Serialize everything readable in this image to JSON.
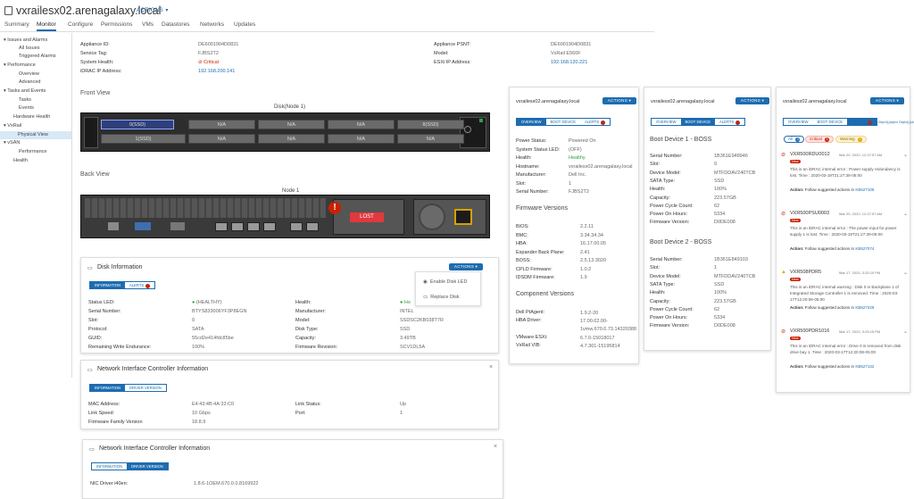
{
  "header": {
    "title": "vxrailesx02.arenagalaxy.local",
    "actions": "ACTIONS"
  },
  "tabs": [
    "Summary",
    "Monitor",
    "Configure",
    "Permissions",
    "VMs",
    "Datastores",
    "Networks",
    "Updates"
  ],
  "sidebar": {
    "items": [
      "Issues and Alarms",
      "All Issues",
      "Triggered Alarms",
      "Performance",
      "Overview",
      "Advanced",
      "Tasks and Events",
      "Tasks",
      "Events",
      "Hardware Health",
      "VxRail",
      "Physical View",
      "vSAN",
      "Performance",
      "Health"
    ]
  },
  "info": {
    "left": [
      [
        "Appliance ID:",
        "DE6001904D0831"
      ],
      [
        "Service Tag:",
        "FJBS2T2"
      ],
      [
        "System Health:",
        "Critical"
      ],
      [
        "iDRAC IP Address:",
        "192.168.200.141"
      ]
    ],
    "right": [
      [
        "Appliance PSNT:",
        "DE6001904D0831"
      ],
      [
        "Model:",
        "VxRail E560F"
      ],
      [
        "ESXi IP Address:",
        "192.168.120.221"
      ]
    ]
  },
  "front": {
    "label": "Front View",
    "node": "Disk(Node 1)",
    "slots": [
      "0(SSD)",
      "N/A",
      "N/A",
      "N/A",
      "N/A",
      "8(SSD)",
      "1(SSD)",
      "N/A",
      "N/A",
      "N/A",
      "N/A",
      "N/A"
    ]
  },
  "back": {
    "label": "Back View",
    "node": "Node 1",
    "lost": "LOST"
  },
  "disk": {
    "title": "Disk Information",
    "tabs": [
      "INFORMATION",
      "ALERTS"
    ],
    "alerts_count": "1",
    "actions": "ACTIONS",
    "menu": [
      "Enable Disk LED",
      "Replace Disk"
    ],
    "left": [
      [
        "Status LED:",
        "(HEALTHY)"
      ],
      [
        "Serial Number:",
        "BTYS833006YF3P8EGN"
      ],
      [
        "Slot:",
        "0"
      ],
      [
        "Protocol:",
        "SATA"
      ],
      [
        "GUID:",
        "55cd2e414fdc85be"
      ],
      [
        "Remaining Write Endurance:",
        "100%"
      ]
    ],
    "right": [
      [
        "Health:",
        "Ho"
      ],
      [
        "Manufacturer:",
        "INTEL"
      ],
      [
        "Model:",
        "SSDSC2KB038T7R"
      ],
      [
        "Disk Type:",
        "SSD"
      ],
      [
        "Capacity:",
        "3.49TB"
      ],
      [
        "Firmware Revision:",
        "SCV1DL5A"
      ]
    ]
  },
  "nic1": {
    "title": "Network Interface Controller Information",
    "tabs": [
      "INFORMATION",
      "DRIVER VERSION"
    ],
    "left": [
      [
        "MAC Address:",
        "E4:43:4B:4A:33:C0"
      ],
      [
        "Link Speed:",
        "10 Gbps"
      ],
      [
        "Firmware Family Version",
        "18.8.9"
      ]
    ],
    "right": [
      [
        "Link Status:",
        "Up"
      ],
      [
        "Port:",
        "1"
      ]
    ]
  },
  "nic2": {
    "title": "Network Interface Controller Information",
    "tabs": [
      "INFORMATION",
      "DRIVER VERSION"
    ],
    "rows": [
      [
        "NIC Driver i40en:",
        "1.8.6-1OEM.670.0.0.8169922"
      ]
    ]
  },
  "p1": {
    "host": "vxrailesx02.arenagalaxy.local",
    "actions": "ACTIONS",
    "tabs": [
      "OVERVIEW",
      "BOOT DEVICE",
      "ALERTS"
    ],
    "alerts": "5",
    "rows": [
      [
        "Power Status:",
        "Powered On"
      ],
      [
        "System Status LED:",
        "(OFF)"
      ],
      [
        "Health:",
        "Healthy"
      ],
      [
        "Hostname:",
        "vxrailesx02.arenagalaxy.local"
      ],
      [
        "Manufacturer:",
        "Dell Inc."
      ],
      [
        "Slot:",
        "1"
      ],
      [
        "Serial Number:",
        "FJBS2T2"
      ]
    ],
    "fw_title": "Firmware Versions",
    "fw": [
      [
        "BIOS:",
        "2.2.11"
      ],
      [
        "BMC:",
        "3.34.34.34"
      ],
      [
        "HBA:",
        "16.17.00.05"
      ],
      [
        "Expander Back Plane:",
        "2.41"
      ],
      [
        "BOSS:",
        "2.5.13.3020"
      ],
      [
        "CPLD Firmware:",
        "1.0.2"
      ],
      [
        "IDSDM Firmware:",
        "1.9"
      ]
    ],
    "comp_title": "Component Versions",
    "comp": [
      [
        "Dell PtAgent:",
        "1.9.2-20"
      ],
      [
        "HBA Driver:",
        "17.00.02.00-1vmw.670.0.73.14320388"
      ],
      [
        "VMware ESXi:",
        "6.7.0-15018017"
      ],
      [
        "VxRail VIB:",
        "4.7.301-15195814"
      ]
    ]
  },
  "p2": {
    "host": "vxrailesx02.arenagalaxy.local",
    "actions": "ACTIONS",
    "tabs": [
      "OVERVIEW",
      "BOOT DEVICE",
      "ALERTS"
    ],
    "alerts": "5",
    "b1": "Boot Device 1 - BOSS",
    "b1rows": [
      [
        "Serial Number:",
        "1B361E948946"
      ],
      [
        "Slot:",
        "0"
      ],
      [
        "Device Model:",
        "MTFDDAV240TCB"
      ],
      [
        "SATA Type:",
        "SSD"
      ],
      [
        "Health:",
        "100%"
      ],
      [
        "Capacity:",
        "223.57GB"
      ],
      [
        "Power Cycle Count:",
        "62"
      ],
      [
        "Power On Hours:",
        "5334"
      ],
      [
        "Firmware Version:",
        "D0DE008"
      ]
    ],
    "b2": "Boot Device 2 - BOSS",
    "b2rows": [
      [
        "Serial Number:",
        "1B361E849103"
      ],
      [
        "Slot:",
        "1"
      ],
      [
        "Device Model:",
        "MTFDDAV240TCB"
      ],
      [
        "SATA Type:",
        "SSD"
      ],
      [
        "Health:",
        "100%"
      ],
      [
        "Capacity:",
        "223.57GB"
      ],
      [
        "Power Cycle Count:",
        "62"
      ],
      [
        "Power On Hours:",
        "5334"
      ],
      [
        "Firmware Version:",
        "D0DE008"
      ]
    ]
  },
  "p3": {
    "host": "vxrailesx02.arenagalaxy.local",
    "actions": "ACTIONS",
    "tabs": [
      "OVERVIEW",
      "BOOT DEVICE",
      "ALERTS"
    ],
    "alerts": [
      {
        "id": "VXR500RDU0012",
        "date": "Mar 20, 2020, 12:37:57 AM",
        "msg": "This is an iDRAC internal error : Power supply redundancy is lost. Time : 2020-03-19T21:27:38-05:00",
        "act": "Action:",
        "actlbl": "Follow suggested actions in",
        "kb": "KB527105"
      },
      {
        "id": "VXR500PSU0003",
        "date": "Mar 20, 2020, 12:37:57 AM",
        "msg": "This is an iDRAC internal error : The power input for power supply 1 is lost. Time : 2020-03-19T21:27:39-05:00",
        "act": "Action:",
        "actlbl": "Follow suggested actions in",
        "kb": "KB527074"
      },
      {
        "id": "VXR508PDR5",
        "date": "Mar 17, 2020, 3:25:19 PM",
        "msg": "This is an iDRAC internal warning : Disk 0 in Backplane 1 of Integrated Storage Controller 1 is removed. Time : 2020-03-17T12:20:06-05:00",
        "act": "Action:",
        "actlbl": "Follow suggested actions in",
        "kb": "KB527229"
      },
      {
        "id": "VXR500PDR1016",
        "date": "Mar 17, 2020, 3:25:15 PM",
        "msg": "This is an iDRAC internal error : Drive 0 is removed from disk drive bay 1. Time : 2020-03-17T12:20:08-05:00",
        "act": "Action:",
        "actlbl": "Follow suggested actions in",
        "kb": "KB527132"
      }
    ],
    "filters": [
      [
        "All",
        "4"
      ],
      [
        "Critical",
        "3"
      ],
      [
        "Warning",
        "1"
      ]
    ],
    "new": "New"
  }
}
